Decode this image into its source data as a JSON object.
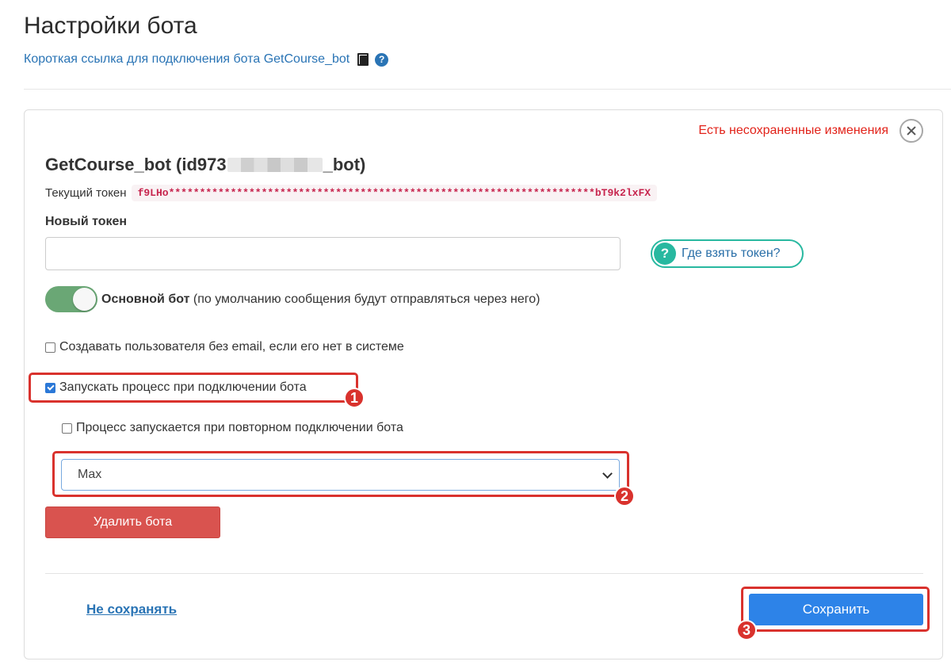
{
  "header": {
    "title": "Настройки бота",
    "short_link": "Короткая ссылка для подключения бота GetCourse_bot",
    "copy_icon": "copy-icon",
    "help_icon": "question-circle-icon",
    "help_glyph": "?"
  },
  "card": {
    "unsaved_text": "Есть несохраненные изменения",
    "close_icon": "close-icon",
    "bot_name_prefix": "GetCourse_bot (id973",
    "bot_name_suffix": "_bot)",
    "current_token_label": "Текущий токен",
    "current_token_value": "f9LHo*********************************************************************bT9k2lxFX",
    "new_token_label": "Новый токен",
    "new_token_value": "",
    "where_token": {
      "glyph": "?",
      "label": "Где взять токен?"
    },
    "main_bot": {
      "enabled": true,
      "bold_label": "Основной бот",
      "note": " (по умолчанию сообщения будут отправляться через него)"
    },
    "checkboxes": [
      {
        "label": "Создавать пользователя без email, если его нет в системе",
        "checked": false
      },
      {
        "label": "Запускать процесс при подключении бота",
        "checked": true
      },
      {
        "label": "Процесс запускается при повторном подключении бота",
        "checked": false
      }
    ],
    "process_select": {
      "selected": "Max"
    },
    "delete_label": "Удалить бота",
    "dont_save_label": "Не сохранять",
    "save_label": "Сохранить"
  },
  "annotations": {
    "color": "#d9322d",
    "badges": [
      "1",
      "2",
      "3"
    ]
  },
  "colors": {
    "link": "#2a74b5",
    "unsaved": "#e2231a",
    "toggle_on": "#6aa775",
    "danger": "#d9534f",
    "primary": "#2d83e8",
    "teal": "#28b8a0"
  }
}
